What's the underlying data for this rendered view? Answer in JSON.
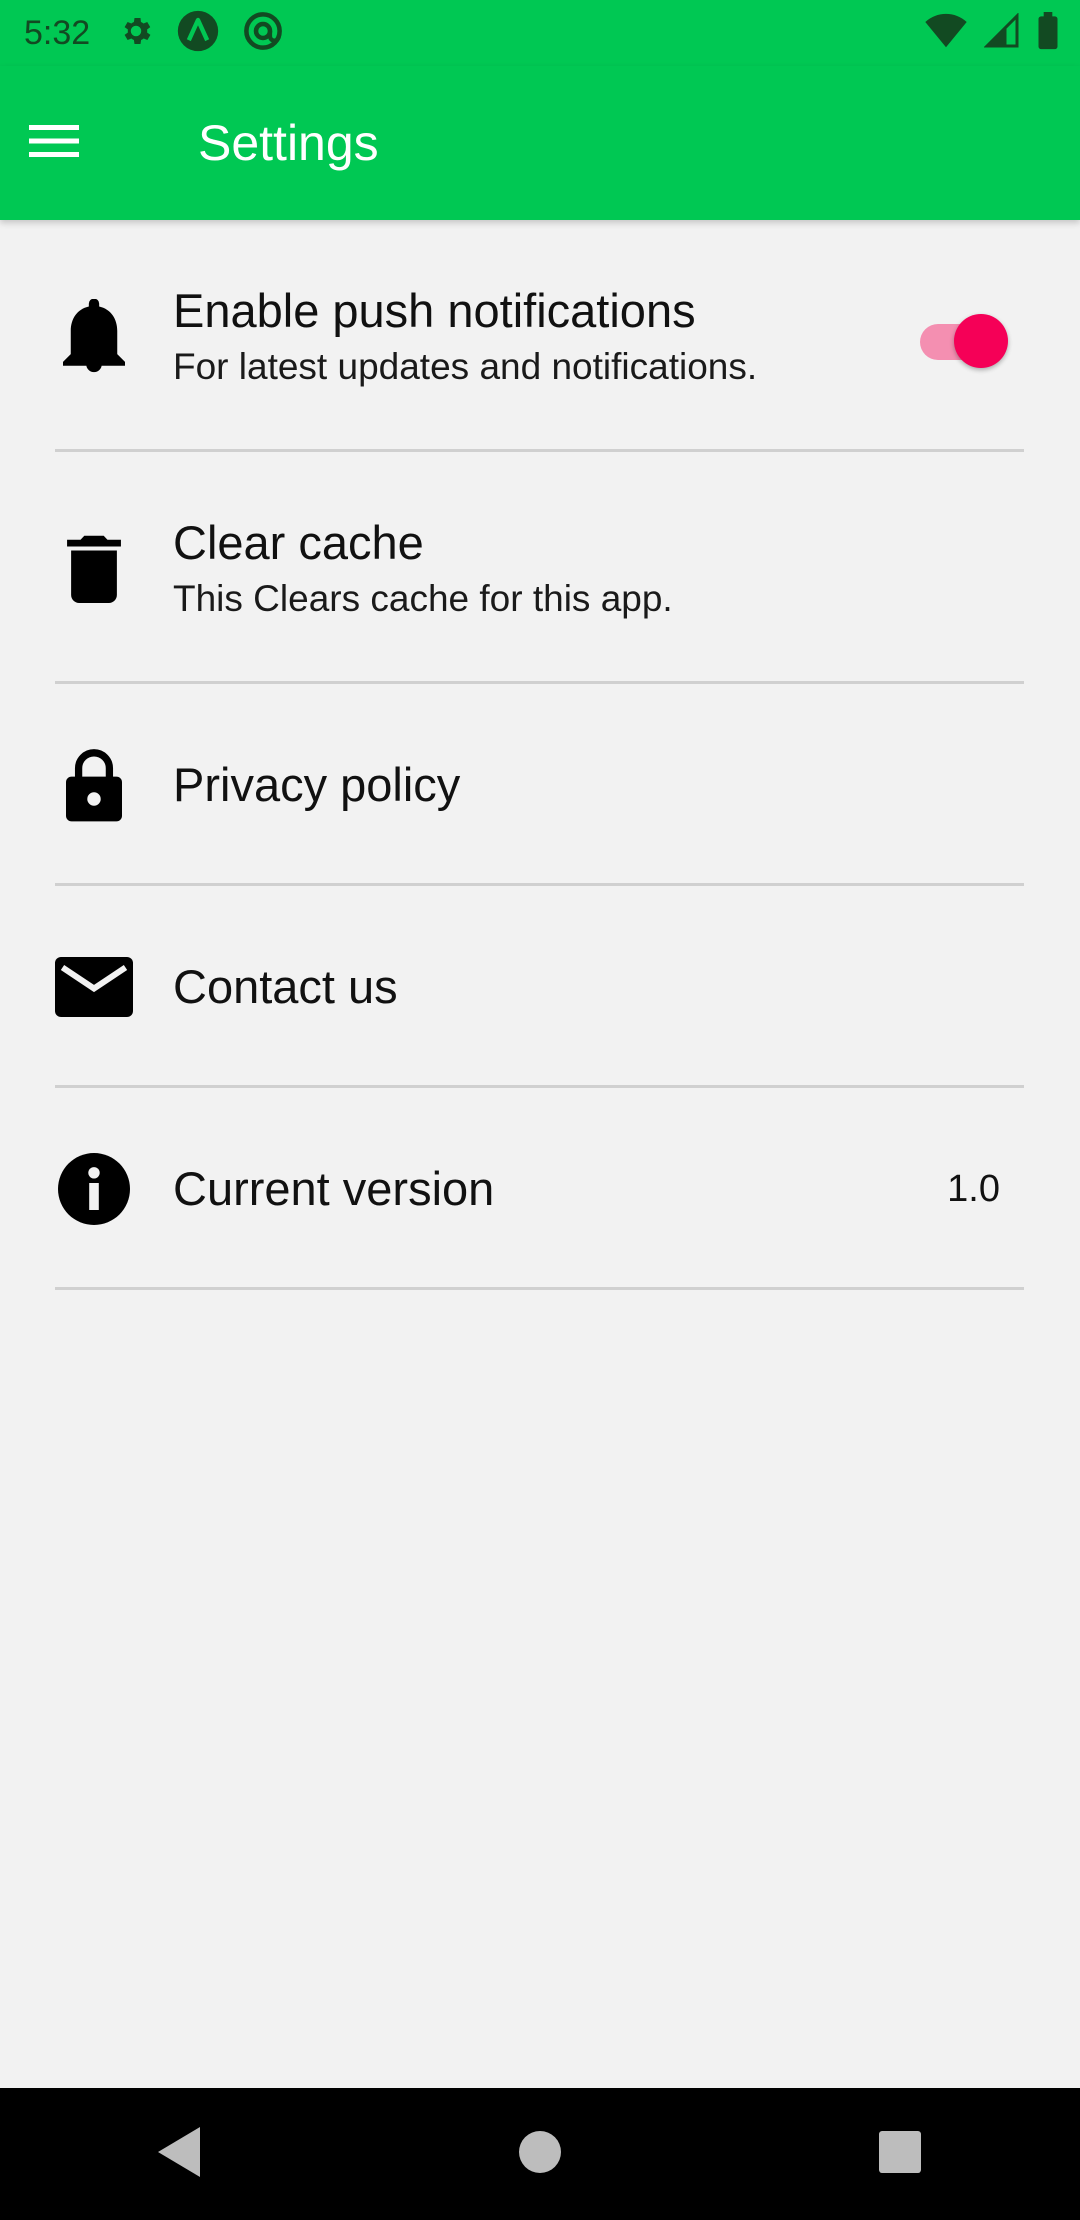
{
  "status_bar": {
    "time": "5:32",
    "icons_left": [
      "gear-icon",
      "a-logo-icon",
      "at-sign-icon"
    ],
    "icons_right": [
      "wifi-icon",
      "signal-icon",
      "battery-icon"
    ]
  },
  "app_bar": {
    "title": "Settings",
    "menu_icon": "hamburger-menu-icon",
    "background": "#00c853"
  },
  "settings": {
    "push_notifications": {
      "title": "Enable push notifications",
      "subtitle": "For latest updates and notifications.",
      "icon": "bell-icon",
      "enabled": true
    },
    "clear_cache": {
      "title": "Clear cache",
      "subtitle": "This Clears cache for this app.",
      "icon": "trash-icon"
    },
    "privacy_policy": {
      "title": "Privacy policy",
      "icon": "lock-icon"
    },
    "contact_us": {
      "title": "Contact us",
      "icon": "mail-icon"
    },
    "current_version": {
      "title": "Current version",
      "value": "1.0",
      "icon": "info-icon"
    }
  },
  "colors": {
    "accent": "#f50057",
    "accent_light": "#f48fb1",
    "primary": "#00c853",
    "background": "#f2f2f2"
  },
  "nav_bar": {
    "icons": [
      "back-icon",
      "home-icon",
      "recents-icon"
    ]
  }
}
